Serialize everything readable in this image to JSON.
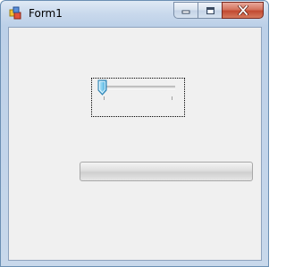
{
  "window": {
    "title": "Form1",
    "icon": "winforms-app-icon",
    "caption_buttons": [
      "minimize-icon",
      "maximize-icon",
      "close-icon"
    ]
  },
  "trackbar": {
    "value": 0,
    "minimum": 0,
    "focused": true
  },
  "progressbar": {
    "value_percent": 0
  }
}
